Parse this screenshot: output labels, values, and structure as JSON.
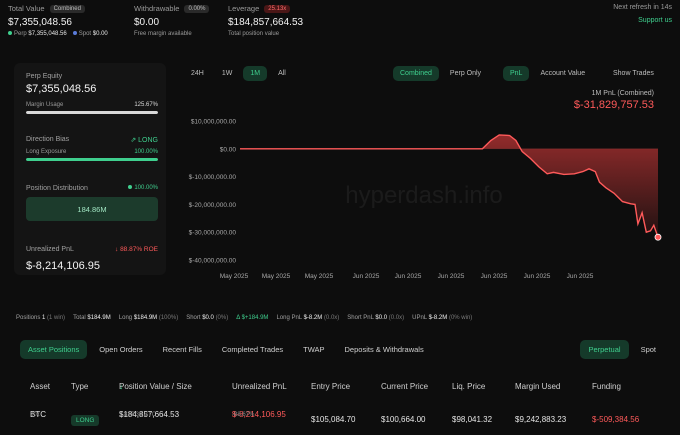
{
  "top": {
    "total_value": {
      "label": "Total Value",
      "badge": "Combined",
      "value": "$7,355,048.56",
      "perp_label": "Perp",
      "perp_value": "$7,355,048.56",
      "spot_label": "Spot",
      "spot_value": "$0.00"
    },
    "withdrawable": {
      "label": "Withdrawable",
      "badge": "0.00%",
      "value": "$0.00",
      "sub": "Free margin available"
    },
    "leverage": {
      "label": "Leverage",
      "badge": "25.13x",
      "value": "$184,857,664.53",
      "sub": "Total position value"
    },
    "refresh": "Next refresh in 14s",
    "support": "Support us"
  },
  "left": {
    "perp_equity_label": "Perp Equity",
    "perp_equity_value": "$7,355,048.56",
    "margin_usage_label": "Margin Usage",
    "margin_usage_value": "125.67%",
    "margin_usage_fraction": 1.0,
    "direction_bias_label": "Direction Bias",
    "direction_bias_value": "LONG",
    "long_exposure_label": "Long Exposure",
    "long_exposure_value": "100.00%",
    "long_exposure_fraction": 1.0,
    "position_distribution_label": "Position Distribution",
    "position_distribution_pct": "100.00%",
    "position_distribution_value": "184.86M",
    "unrealized_label": "Unrealized PnL",
    "unrealized_roe": "88.87% ROE",
    "unrealized_value": "$-8,214,106.95"
  },
  "chart_tabs": {
    "range": [
      "24H",
      "1W",
      "1M",
      "All"
    ],
    "range_active": "1M",
    "mode": [
      "Combined",
      "Perp Only"
    ],
    "mode_active": "Combined",
    "metric": [
      "PnL",
      "Account Value"
    ],
    "metric_active": "PnL",
    "show_trades": "Show Trades"
  },
  "chart_title": {
    "label": "1M PnL (Combined)",
    "value": "$-31,829,757.53"
  },
  "watermark": "hyperdash.info",
  "chart_data": {
    "type": "area",
    "yticks": [
      "$10,000,000.00",
      "$0.00",
      "$-10,000,000.00",
      "$-20,000,000.00",
      "$-30,000,000.00",
      "$-40,000,000.00"
    ],
    "ylim": [
      -40000000,
      10000000
    ],
    "xticks": [
      "May 2025",
      "May 2025",
      "May 2025",
      "Jun 2025",
      "Jun 2025",
      "Jun 2025",
      "Jun 2025",
      "Jun 2025",
      "Jun 2025"
    ],
    "color": "#ff5a5a",
    "points": [
      [
        0,
        0
      ],
      [
        0.58,
        0
      ],
      [
        0.6,
        3000000
      ],
      [
        0.62,
        5000000
      ],
      [
        0.645,
        4800000
      ],
      [
        0.66,
        3000000
      ],
      [
        0.675,
        -1000000
      ],
      [
        0.695,
        -3500000
      ],
      [
        0.715,
        -6500000
      ],
      [
        0.735,
        -9000000
      ],
      [
        0.75,
        -8500000
      ],
      [
        0.775,
        -9200000
      ],
      [
        0.8,
        -9000000
      ],
      [
        0.82,
        -8200000
      ],
      [
        0.835,
        -7200000
      ],
      [
        0.85,
        -8200000
      ],
      [
        0.86,
        -12000000
      ],
      [
        0.875,
        -14000000
      ],
      [
        0.895,
        -16000000
      ],
      [
        0.915,
        -19000000
      ],
      [
        0.935,
        -19800000
      ],
      [
        0.945,
        -20000000
      ],
      [
        0.952,
        -27000000
      ],
      [
        0.962,
        -23000000
      ],
      [
        0.972,
        -30000000
      ],
      [
        0.982,
        -29500000
      ],
      [
        0.99,
        -27500000
      ],
      [
        1.0,
        -31800000
      ]
    ]
  },
  "summary": {
    "positions_label": "Positions",
    "positions_value": "1",
    "positions_note": "(1 win)",
    "total_label": "Total",
    "total_value": "$184.9M",
    "long_label": "Long",
    "long_value": "$184.9M",
    "long_note": "(100%)",
    "short_label": "Short",
    "short_value": "$0.0",
    "short_note": "(0%)",
    "delta": "Δ $+184.9M",
    "long_pnl_label": "Long PnL",
    "long_pnl_value": "$-8.2M",
    "long_pnl_note": "(0.0x)",
    "short_pnl_label": "Short PnL",
    "short_pnl_value": "$0.0",
    "short_pnl_note": "(0.0x)",
    "upnl_label": "UPnL",
    "upnl_value": "$-8.2M",
    "upnl_note": "(0% win)"
  },
  "bottom_tabs": [
    "Asset Positions",
    "Open Orders",
    "Recent Fills",
    "Completed Trades",
    "TWAP",
    "Deposits & Withdrawals"
  ],
  "bottom_tab_active": "Asset Positions",
  "market_tabs": [
    "Perpetual",
    "Spot"
  ],
  "market_tab_active": "Perpetual",
  "table": {
    "headers": [
      "Asset",
      "Type",
      "Position Value / Size",
      "Unrealized PnL",
      "Entry Price",
      "Current Price",
      "Liq. Price",
      "Margin Used",
      "Funding"
    ],
    "sort_icon": "↓",
    "row": {
      "asset": "BTC",
      "leverage": "20x",
      "type": "LONG",
      "position_value": "$184,857,664.53",
      "size": "1,837.30 BTC",
      "upnl": "$-8,214,106.95",
      "upnl_pct": "-88.67%",
      "entry": "$105,084.70",
      "current": "$100,664.00",
      "liq": "$98,041.32",
      "margin": "$9,242,883.23",
      "funding": "$-509,384.56"
    }
  }
}
